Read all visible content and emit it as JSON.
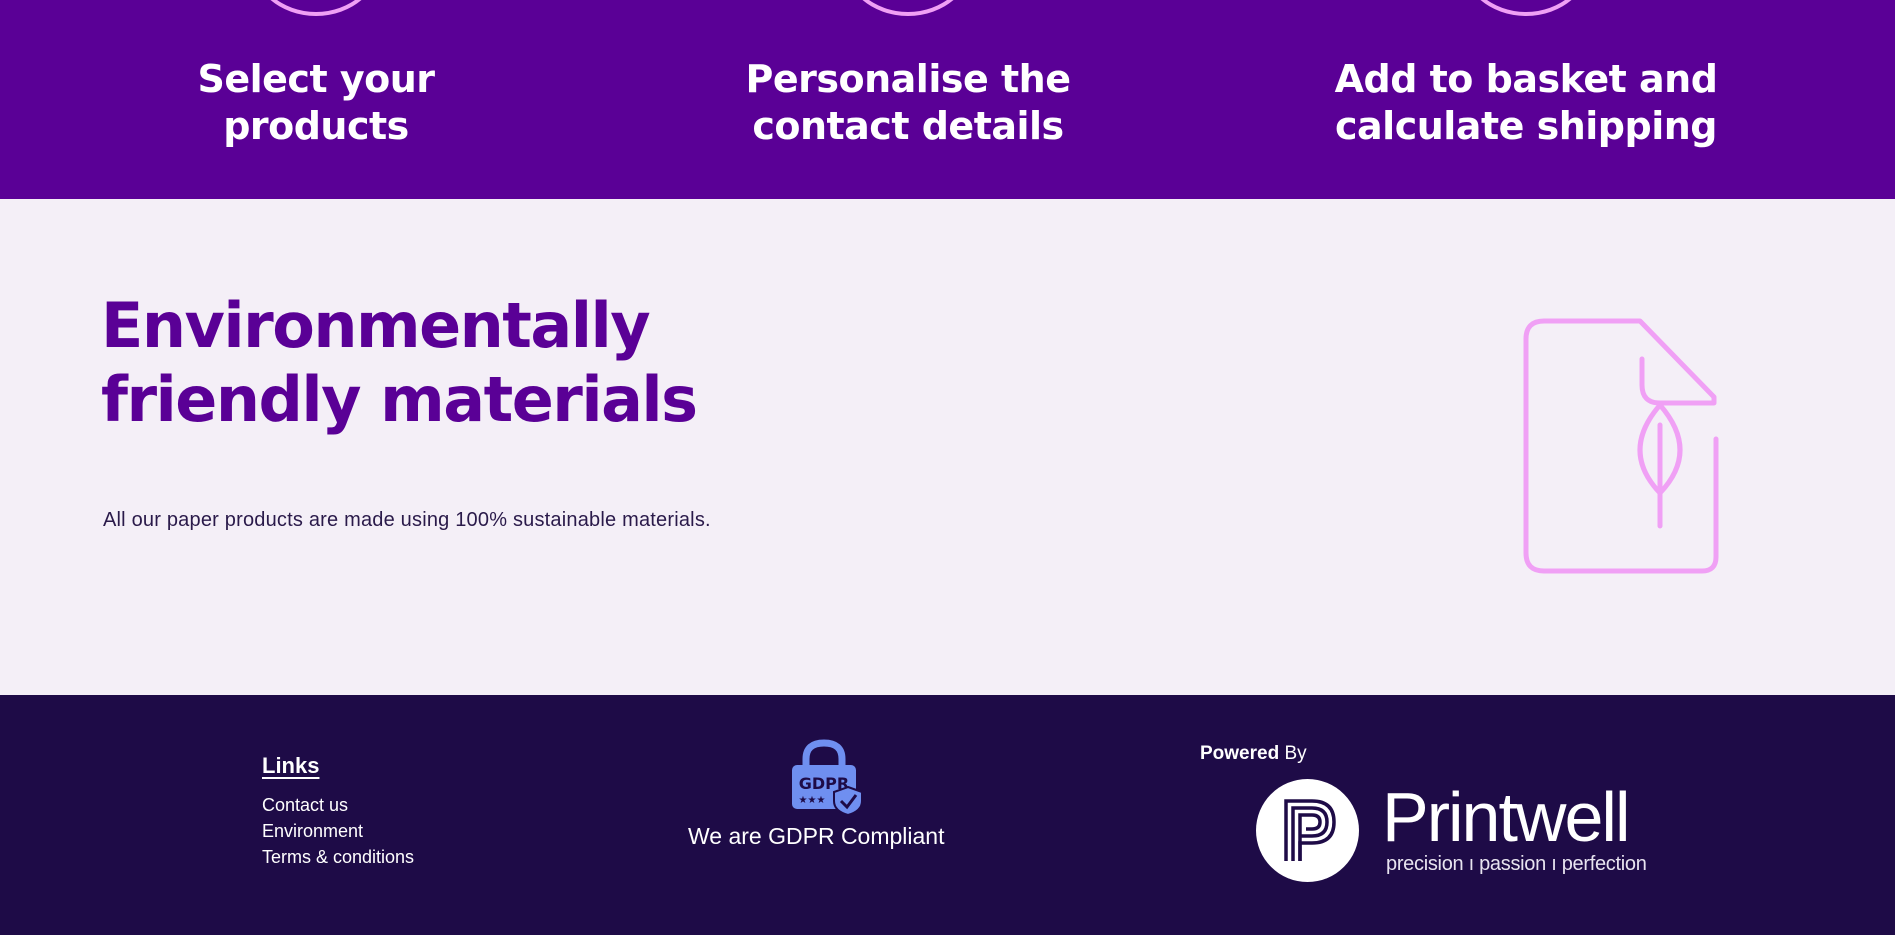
{
  "colors": {
    "steps_bg": "#5a0096",
    "accent_pink": "#f0a0f5",
    "env_bg": "#f4eff7",
    "env_title": "#5a0096",
    "footer_bg": "#1e0b47",
    "gdpr_blue": "#6f8ff0"
  },
  "steps": [
    {
      "icon": "circle-icon",
      "line1": "Select your",
      "line2": "products"
    },
    {
      "icon": "circle-icon",
      "line1": "Personalise the",
      "line2": "contact details"
    },
    {
      "icon": "circle-icon",
      "line1": "Add to basket and",
      "line2": "calculate shipping"
    }
  ],
  "environment": {
    "title_line1": "Environmentally",
    "title_line2": "friendly materials",
    "text": "All our paper products are made using 100% sustainable materials.",
    "icon": "eco-document-icon"
  },
  "footer": {
    "links_heading": "Links",
    "links": [
      "Contact us",
      "Environment",
      "Terms & conditions"
    ],
    "gdpr_icon": "gdpr-lock-icon",
    "gdpr_icon_text": "GDPR",
    "gdpr_text": "We are GDPR Compliant",
    "powered_bold": "Powered",
    "powered_rest": "By",
    "brand_name": "Printwell",
    "brand_tagline": "precision ı passion ı perfection"
  }
}
